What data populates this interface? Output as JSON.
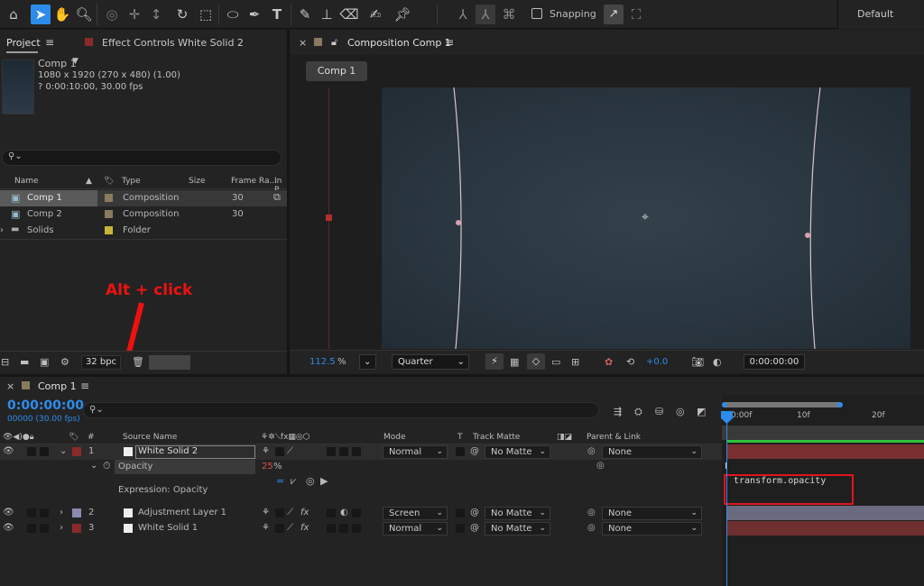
{
  "toolbar": {
    "icons": [
      "home-icon",
      "selection-tool-icon",
      "hand-tool-icon",
      "zoom-tool-icon",
      "orbit-camera-icon",
      "pan-camera-icon",
      "dolly-camera-icon",
      "rotate-tool-icon",
      "pan-behind-icon",
      "ellipse-tool-icon",
      "pen-tool-icon",
      "type-tool-icon",
      "brush-tool-icon",
      "clone-stamp-icon",
      "eraser-icon",
      "roto-brush-icon",
      "puppet-pin-icon"
    ],
    "snapping_label": "Snapping",
    "workspace_label": "Default"
  },
  "project_panel": {
    "tab_project": "Project",
    "tab_effect_controls": "Effect Controls White Solid 2",
    "selected_item_name": "Comp 1",
    "selected_item_dims": "1080 x 1920  (270 x 480) (1.00)",
    "selected_item_duration": "? 0:00:10:00, 30.00 fps",
    "columns": {
      "name": "Name",
      "type": "Type",
      "size": "Size",
      "frame_rate": "Frame Ra...",
      "in_point": "In P"
    },
    "items": [
      {
        "name": "Comp 1",
        "type": "Composition",
        "size": "",
        "frame_rate": "30",
        "color": "#8a7a5e"
      },
      {
        "name": "Comp 2",
        "type": "Composition",
        "size": "",
        "frame_rate": "30",
        "color": "#8a7a5e"
      },
      {
        "name": "Solids",
        "type": "Folder",
        "size": "",
        "frame_rate": "",
        "color": "#c8b43a"
      }
    ],
    "bit_depth": "32 bpc"
  },
  "composition_panel": {
    "tab_title": "Composition Comp 1",
    "comp_tab": "Comp 1",
    "zoom": "112.5",
    "zoom_unit": "%",
    "resolution": "Quarter",
    "exposure": "+0.0",
    "timecode": "0:00:00:00"
  },
  "timeline": {
    "tab_title": "Comp 1",
    "timecode": "0:00:00:00",
    "fps": "00000 (30.00 fps)",
    "columns": {
      "number": "#",
      "source_name": "Source Name",
      "mode": "Mode",
      "t": "T",
      "track_matte": "Track Matte",
      "parent": "Parent & Link"
    },
    "ruler_ticks": [
      "0:00f",
      "10f",
      "20f"
    ],
    "layers": [
      {
        "number": "1",
        "name": "White Solid 2",
        "mode": "Normal",
        "matte": "No Matte",
        "parent": "None",
        "color": "#8b2a2a"
      },
      {
        "number": "2",
        "name": "Adjustment Layer 1",
        "mode": "Screen",
        "matte": "No Matte",
        "parent": "None",
        "color": "#8a8ab0"
      },
      {
        "number": "3",
        "name": "White Solid 1",
        "mode": "Normal",
        "matte": "No Matte",
        "parent": "None",
        "color": "#8b2a2a"
      }
    ],
    "property_name": "Opacity",
    "property_value": "25",
    "property_unit": "%",
    "expression_label": "Expression: Opacity",
    "expression_text": "transform.opacity"
  },
  "annotation": {
    "text": "Alt + click",
    "color": "#ee1111"
  }
}
